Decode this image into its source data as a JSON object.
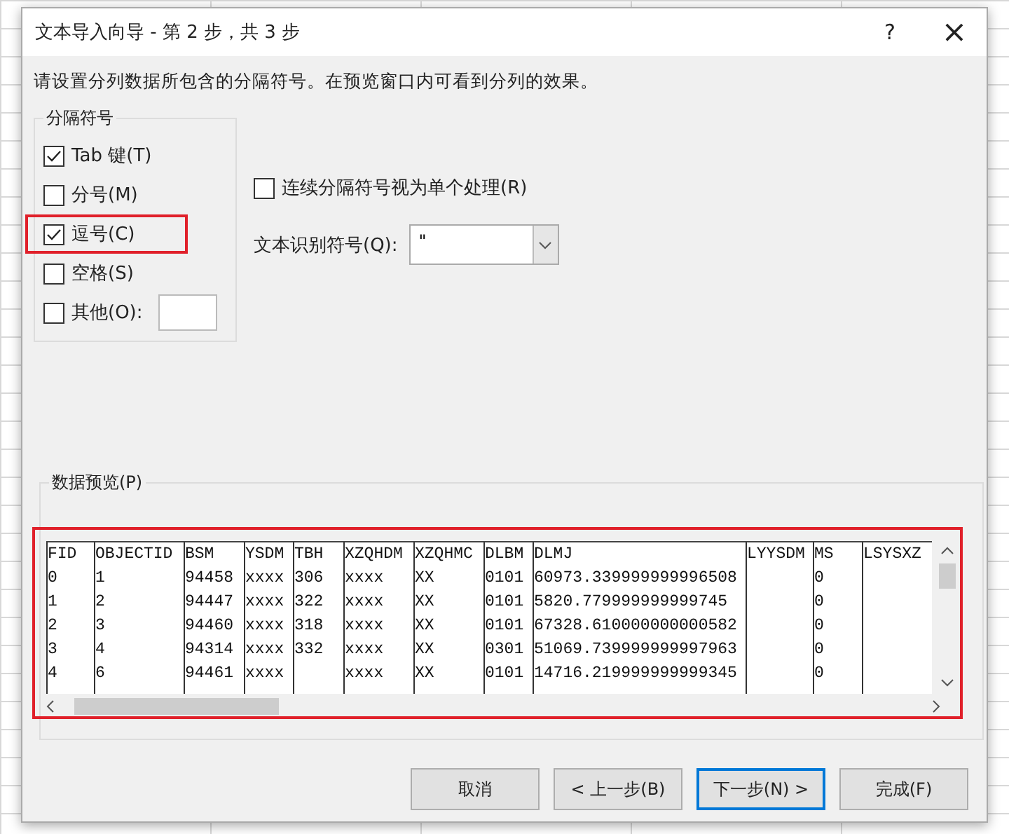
{
  "window": {
    "title": "文本导入向导 - 第 2 步，共 3 步",
    "help": "?",
    "close": "×"
  },
  "instruction": "请设置分列数据所包含的分隔符号。在预览窗口内可看到分列的效果。",
  "delimiters": {
    "title": "分隔符号",
    "items": [
      {
        "label": "Tab 键(T)",
        "checked": true,
        "highlighted": false
      },
      {
        "label": "分号(M)",
        "checked": false,
        "highlighted": false
      },
      {
        "label": "逗号(C)",
        "checked": true,
        "highlighted": true
      },
      {
        "label": "空格(S)",
        "checked": false,
        "highlighted": false
      },
      {
        "label": "其他(O):",
        "checked": false,
        "highlighted": false,
        "has_field": true
      }
    ]
  },
  "consecutive": {
    "label": "连续分隔符号视为单个处理(R)",
    "checked": false
  },
  "qualifier": {
    "label": "文本识别符号(Q):",
    "value": "\""
  },
  "preview": {
    "title": "数据预览(P)",
    "highlighted": true,
    "columns": [
      "FID",
      "OBJECTID",
      "BSM",
      "YSDM",
      "TBH",
      "XZQHDM",
      "XZQHMC",
      "DLBM",
      "DLMJ",
      "LYYSDM",
      "MS",
      "LSYSXZ"
    ],
    "rows": [
      [
        "0",
        "1",
        "94458",
        "xxxx",
        "306",
        "xxxx",
        "XX",
        "0101",
        "60973.339999999996508",
        "",
        "0",
        ""
      ],
      [
        "1",
        "2",
        "94447",
        "xxxx",
        "322",
        "xxxx",
        "XX",
        "0101",
        "5820.779999999999745",
        "",
        "0",
        ""
      ],
      [
        "2",
        "3",
        "94460",
        "xxxx",
        "318",
        "xxxx",
        "XX",
        "0101",
        "67328.610000000000582",
        "",
        "0",
        ""
      ],
      [
        "3",
        "4",
        "94314",
        "xxxx",
        "332",
        "xxxx",
        "XX",
        "0301",
        "51069.739999999997963",
        "",
        "0",
        ""
      ],
      [
        "4",
        "6",
        "94461",
        "xxxx",
        "",
        "xxxx",
        "XX",
        "0101",
        "14716.219999999999345",
        "",
        "0",
        ""
      ]
    ]
  },
  "buttons": [
    {
      "label": "取消",
      "default": false
    },
    {
      "label": "< 上一步(B)",
      "default": false
    },
    {
      "label": "下一步(N) >",
      "default": true
    },
    {
      "label": "完成(F)",
      "default": false
    }
  ]
}
